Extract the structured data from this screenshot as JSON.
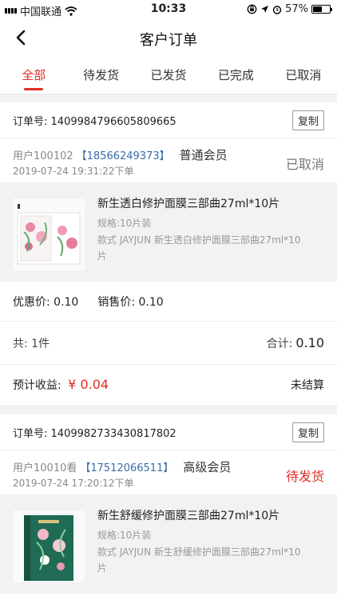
{
  "status_bar": {
    "carrier": "中国联通",
    "time": "10:33",
    "battery": "57%",
    "battery_level": 0.57,
    "icons": [
      "signal-icon",
      "wifi-icon",
      "lock-rotation-icon",
      "location-icon",
      "alarm-icon",
      "battery-icon"
    ]
  },
  "nav": {
    "title": "客户订单",
    "back_icon": "chevron-left-icon"
  },
  "tabs": [
    {
      "label": "全部",
      "active": true
    },
    {
      "label": "待发货",
      "active": false
    },
    {
      "label": "已发货",
      "active": false
    },
    {
      "label": "已完成",
      "active": false
    },
    {
      "label": "已取消",
      "active": false
    }
  ],
  "colors": {
    "accent": "#e02e24",
    "link": "#3a6aa8",
    "muted": "#888888"
  },
  "orders": [
    {
      "order_no_label": "订单号:",
      "order_no": "1409984796605809665",
      "copy_label": "复制",
      "user": "用户100102",
      "phone": "【18566249373】",
      "level": "普通会员",
      "date": "2019-07-24 19:31:22下单",
      "status": "已取消",
      "product": {
        "title": "新生透白修护面膜三部曲27ml*10片",
        "spec": "规格:10片装",
        "style": "款式 JAYJUN 新生透白修护面膜三部曲27ml*10片",
        "image": "white-mask-box-image"
      },
      "discount_price": "优惠价: 0.10",
      "sale_price": "销售价: 0.10",
      "qty": "共: 1件",
      "total_label": "合计:",
      "total": "0.10",
      "income_label": "预计收益:",
      "income": "¥ 0.04",
      "settle_status": "未结算"
    },
    {
      "order_no_label": "订单号:",
      "order_no": "1409982733430817802",
      "copy_label": "复制",
      "user": "用户10010看",
      "phone": "【17512066511】",
      "level": "高级会员",
      "date": "2019-07-24 17:20:12下单",
      "status": "待发货",
      "product": {
        "title": "新生舒缓修护面膜三部曲27ml*10片",
        "spec": "规格:10片装",
        "style": "款式 JAYJUN 新生舒缓修护面膜三部曲27ml*10片",
        "image": "green-mask-box-image"
      }
    }
  ]
}
